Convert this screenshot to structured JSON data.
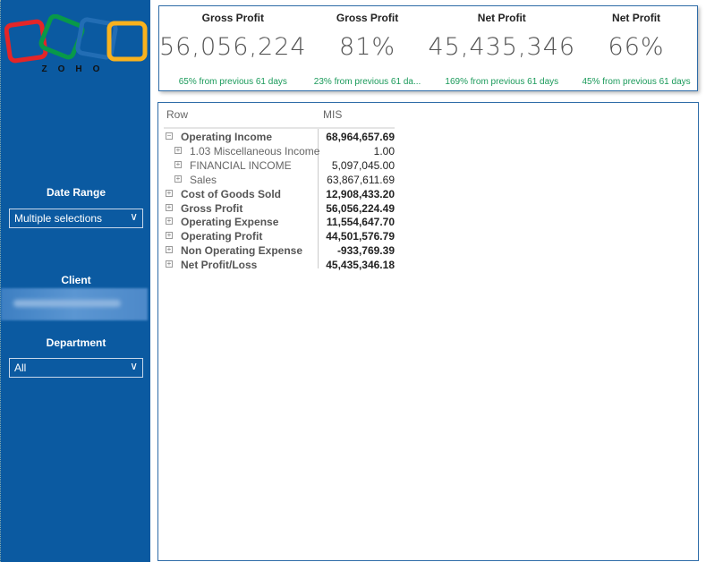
{
  "sidebar": {
    "logo_text": "ZOHO",
    "date_range": {
      "label": "Date Range",
      "value": "Multiple selections"
    },
    "client": {
      "label": "Client"
    },
    "department": {
      "label": "Department",
      "value": "All"
    },
    "background": "#0b5aa1"
  },
  "kpis": [
    {
      "title": "Gross Profit",
      "value": "56,056,224",
      "change": "65% from previous 61 days"
    },
    {
      "title": "Gross Profit",
      "value": "81%",
      "change": "23% from previous 61 da..."
    },
    {
      "title": "Net Profit",
      "value": "45,435,346",
      "change": "169% from previous 61 days"
    },
    {
      "title": "Net Profit",
      "value": "66%",
      "change": "45% from previous 61 days"
    }
  ],
  "matrix": {
    "headers": {
      "row": "Row",
      "value": "MIS"
    },
    "rows": [
      {
        "label": "Operating Income",
        "value": "68,964,657.69",
        "level": 0,
        "expanded": true,
        "icon": "collapse-icon"
      },
      {
        "label": "1.03 Miscellaneous Income",
        "value": "1.00",
        "level": 1,
        "icon": "expand-icon"
      },
      {
        "label": "FINANCIAL INCOME",
        "value": "5,097,045.00",
        "level": 1,
        "icon": "expand-icon"
      },
      {
        "label": "Sales",
        "value": "63,867,611.69",
        "level": 1,
        "icon": "expand-icon"
      },
      {
        "label": "Cost of Goods Sold",
        "value": "12,908,433.20",
        "level": 0,
        "icon": "expand-icon"
      },
      {
        "label": "Gross Profit",
        "value": "56,056,224.49",
        "level": 0,
        "icon": "expand-icon"
      },
      {
        "label": "Operating Expense",
        "value": "11,554,647.70",
        "level": 0,
        "icon": "expand-icon"
      },
      {
        "label": "Operating Profit",
        "value": "44,501,576.79",
        "level": 0,
        "icon": "expand-icon"
      },
      {
        "label": "Non Operating Expense",
        "value": "-933,769.39",
        "level": 0,
        "icon": "expand-icon"
      },
      {
        "label": "Net Profit/Loss",
        "value": "45,435,346.18",
        "level": 0,
        "icon": "expand-icon"
      }
    ]
  },
  "colors": {
    "positive_change": "#1a9a5a",
    "accent_border": "#2e6ca8"
  }
}
